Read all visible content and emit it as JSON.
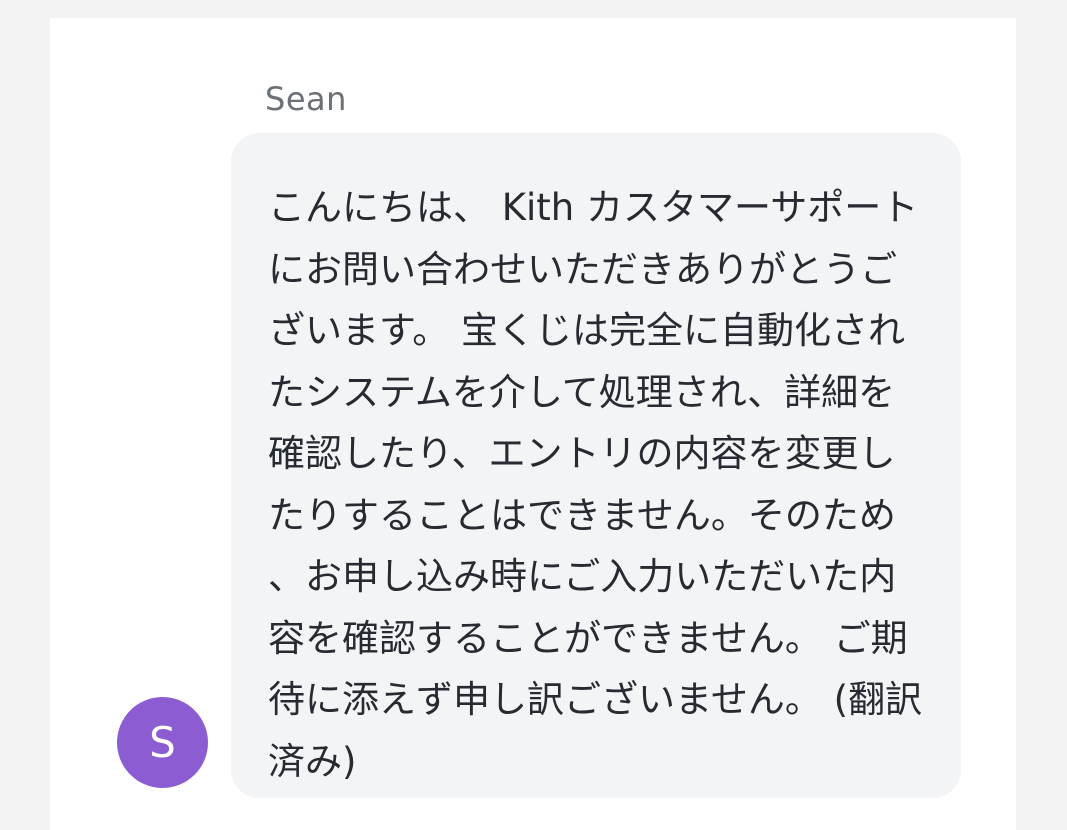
{
  "message": {
    "sender_name": "Sean",
    "avatar_initial": "S",
    "text": "こんにちは、 Kith カスタマーサポートにお問い合わせいただきありがとうございます。 宝くじは完全に自動化されたシステムを介して処理され、詳細を確認したり、エントリの内容を変更したりすることはできません。そのため、お申し込み時にご入力いただいた内容を確認することができません。 ご期待に添えず申し訳ございません。 (翻訳済み)"
  },
  "colors": {
    "avatar_bg": "#8c5cd3",
    "bubble_bg": "#f3f4f6",
    "page_bg": "#f3f3f4"
  }
}
